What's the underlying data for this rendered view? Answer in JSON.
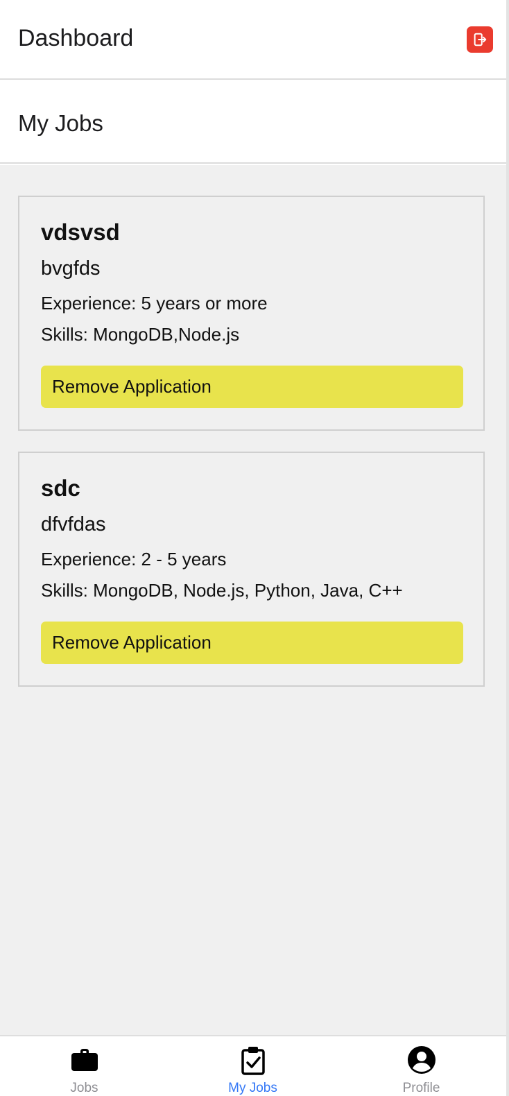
{
  "header": {
    "title": "Dashboard",
    "logout_icon": "logout-icon",
    "logout_color": "#ea3b2e"
  },
  "subheader": {
    "title": "My Jobs"
  },
  "jobs": [
    {
      "title": "vdsvsd",
      "company": "bvgfds",
      "experience": "Experience: 5 years or more",
      "skills": "Skills: MongoDB,Node.js",
      "action_label": "Remove Application"
    },
    {
      "title": "sdc",
      "company": "dfvfdas",
      "experience": "Experience: 2 - 5 years",
      "skills": "Skills: MongoDB, Node.js, Python, Java, C++",
      "action_label": "Remove Application"
    }
  ],
  "tabs": [
    {
      "label": "Jobs",
      "icon": "briefcase-icon",
      "active": false
    },
    {
      "label": "My Jobs",
      "icon": "clipboard-check-icon",
      "active": true
    },
    {
      "label": "Profile",
      "icon": "user-circle-icon",
      "active": false
    }
  ],
  "colors": {
    "accent": "#3478f6",
    "button": "#e8e34c",
    "background": "#f0f0f0"
  }
}
